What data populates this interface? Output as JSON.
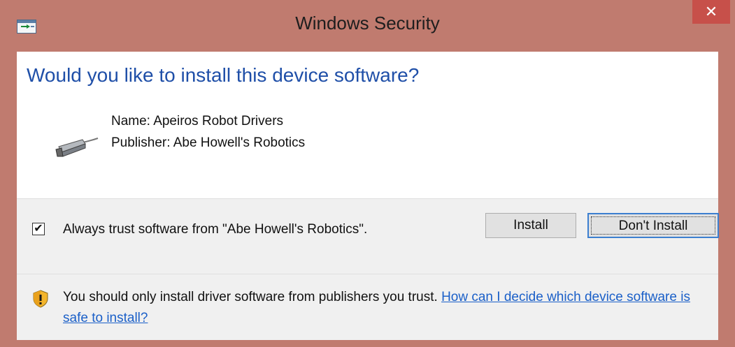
{
  "window": {
    "title": "Windows Security",
    "close_glyph": "✕"
  },
  "dialog": {
    "heading": "Would you like to install this device software?",
    "name_line": "Name: Apeiros Robot Drivers",
    "publisher_line": "Publisher: Abe Howell's Robotics",
    "always_trust_checked": true,
    "checkbox_glyph": "✔",
    "always_trust_label": "Always trust software from \"Abe Howell's Robotics\".",
    "install_label": "Install",
    "dont_install_label": "Don't Install",
    "warning_text": "You should only install driver software from publishers you trust.",
    "help_link": "How can I decide which device software is safe to install?"
  },
  "icons": {
    "title": "device-install-icon",
    "device": "serial-cable-icon",
    "warning": "security-shield-icon"
  }
}
